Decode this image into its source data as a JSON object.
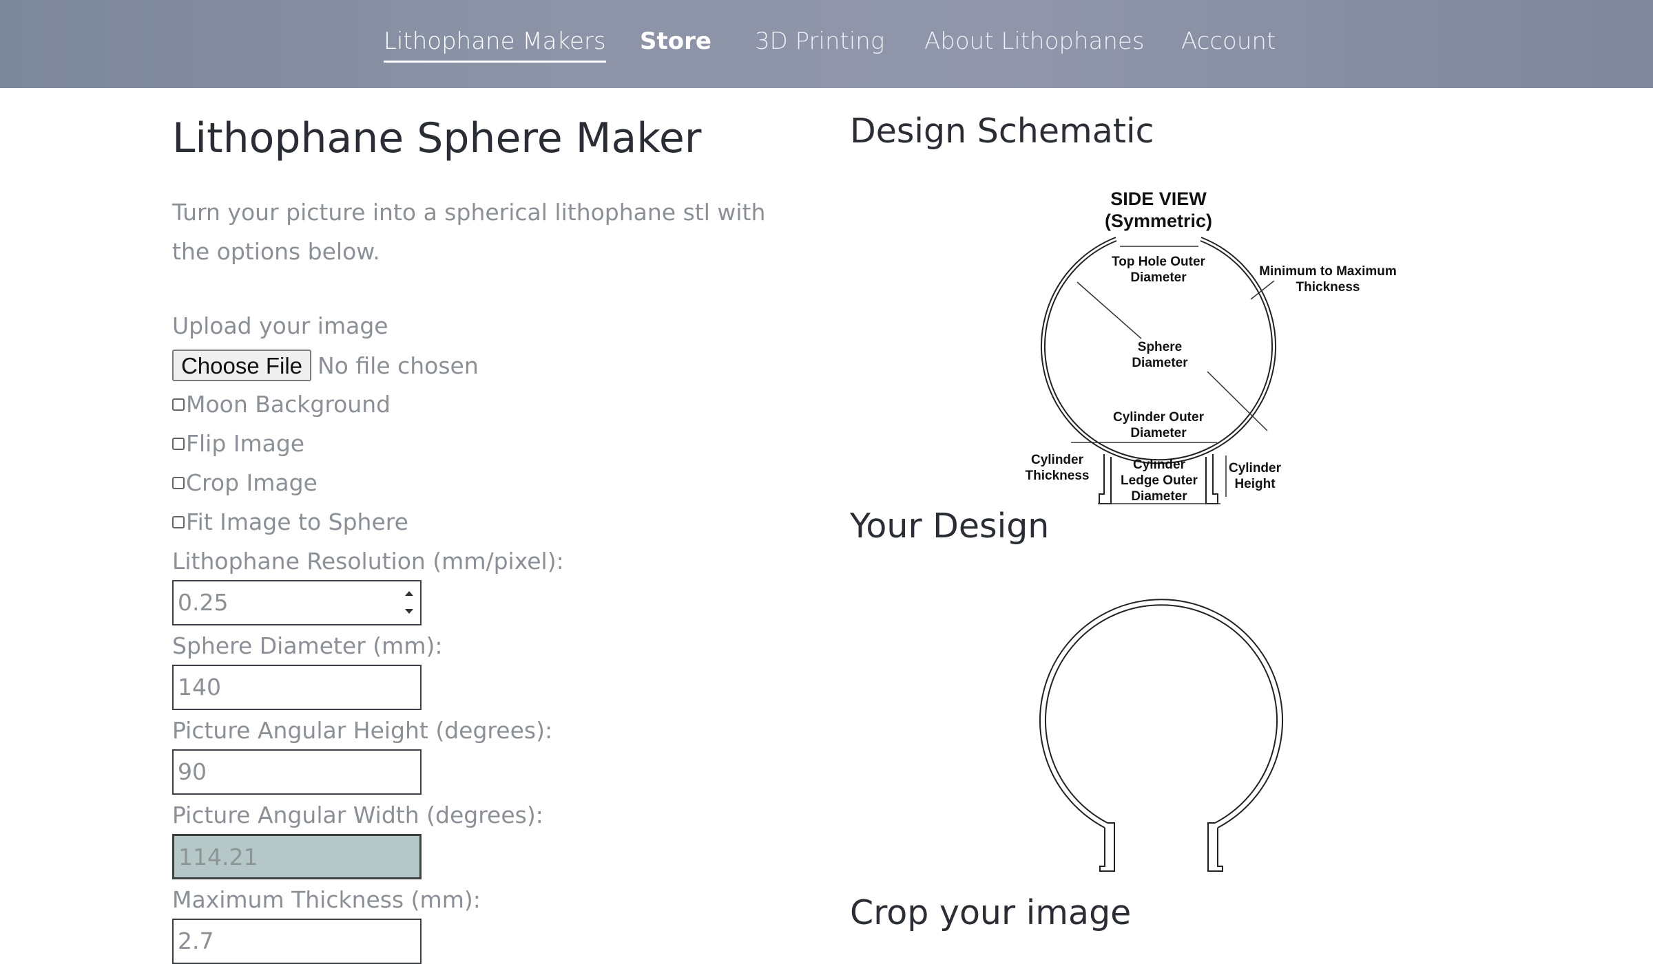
{
  "nav": {
    "items": [
      "Lithophane Makers",
      "Store",
      "3D Printing",
      "About Lithophanes",
      "Account"
    ]
  },
  "page": {
    "title": "Lithophane Sphere Maker",
    "intro": "Turn your picture into a spherical lithophane stl with the options below."
  },
  "upload": {
    "label": "Upload your image",
    "button": "Choose File",
    "status": "No file chosen"
  },
  "options": {
    "moon_background": "Moon Background",
    "flip_image": "Flip Image",
    "crop_image": "Crop Image",
    "fit_image": "Fit Image to Sphere"
  },
  "fields": {
    "resolution": {
      "label": "Lithophane Resolution (mm/pixel):",
      "value": "0.25"
    },
    "sphere_diameter": {
      "label": "Sphere Diameter (mm):",
      "value": "140"
    },
    "angular_height": {
      "label": "Picture Angular Height (degrees):",
      "value": "90"
    },
    "angular_width": {
      "label": "Picture Angular Width (degrees):",
      "value": "114.21"
    },
    "max_thickness": {
      "label": "Maximum Thickness (mm):",
      "value": "2.7"
    }
  },
  "right": {
    "schematic_heading": "Design Schematic",
    "design_heading": "Your Design",
    "crop_heading": "Crop your image"
  },
  "schematic": {
    "side_view": "SIDE VIEW",
    "symmetric": "(Symmetric)",
    "top_hole_1": "Top Hole Outer",
    "top_hole_2": "Diameter",
    "min_max_1": "Minimum to Maximum",
    "min_max_2": "Thickness",
    "sphere_1": "Sphere",
    "sphere_2": "Diameter",
    "cyl_outer_1": "Cylinder Outer",
    "cyl_outer_2": "Diameter",
    "cyl_thick_1": "Cylinder",
    "cyl_thick_2": "Thickness",
    "cyl_ledge_1": "Cylinder",
    "cyl_ledge_2": "Ledge Outer",
    "cyl_ledge_3": "Diameter",
    "cyl_height_1": "Cylinder",
    "cyl_height_2": "Height"
  }
}
